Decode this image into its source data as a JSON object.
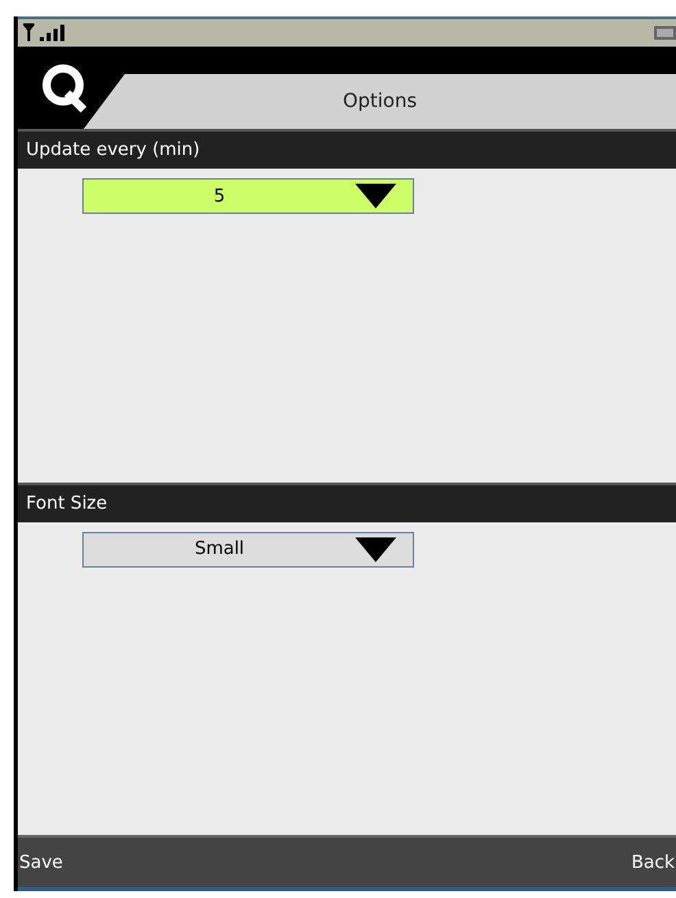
{
  "header": {
    "title": "Options"
  },
  "sections": [
    {
      "label": "Update every (min)",
      "value": "5",
      "focused": true
    },
    {
      "label": "Font Size",
      "value": "Small",
      "focused": false
    }
  ],
  "softkeys": {
    "left": "Save",
    "right": "Back"
  }
}
